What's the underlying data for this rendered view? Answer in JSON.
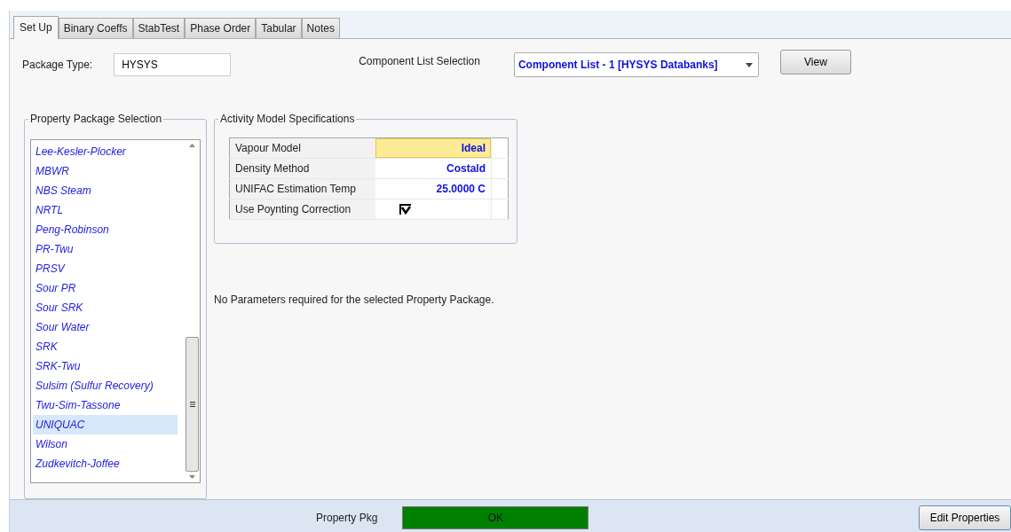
{
  "tabs": [
    {
      "label": "Set Up",
      "selected": true
    },
    {
      "label": "Binary Coeffs",
      "selected": false
    },
    {
      "label": "StabTest",
      "selected": false
    },
    {
      "label": "Phase Order",
      "selected": false
    },
    {
      "label": "Tabular",
      "selected": false
    },
    {
      "label": "Notes",
      "selected": false
    }
  ],
  "package_type": {
    "label": "Package Type:",
    "value": "HYSYS"
  },
  "component_list": {
    "label": "Component List Selection",
    "value": "Component List - 1 [HYSYS Databanks]",
    "button": "View"
  },
  "property_package": {
    "title": "Property Package Selection",
    "items": [
      {
        "label": "Lee-Kesler-Plocker",
        "selected": false
      },
      {
        "label": "MBWR",
        "selected": false
      },
      {
        "label": "NBS Steam",
        "selected": false
      },
      {
        "label": "NRTL",
        "selected": false
      },
      {
        "label": "Peng-Robinson",
        "selected": false
      },
      {
        "label": "PR-Twu",
        "selected": false
      },
      {
        "label": "PRSV",
        "selected": false
      },
      {
        "label": "Sour PR",
        "selected": false
      },
      {
        "label": "Sour SRK",
        "selected": false
      },
      {
        "label": "Sour Water",
        "selected": false
      },
      {
        "label": "SRK",
        "selected": false
      },
      {
        "label": "SRK-Twu",
        "selected": false
      },
      {
        "label": "Sulsim (Sulfur Recovery)",
        "selected": false
      },
      {
        "label": "Twu-Sim-Tassone",
        "selected": false
      },
      {
        "label": "UNIQUAC",
        "selected": true
      },
      {
        "label": "Wilson",
        "selected": false
      },
      {
        "label": "Zudkevitch-Joffee",
        "selected": false
      }
    ]
  },
  "activity_model": {
    "title": "Activity Model Specifications",
    "rows": [
      {
        "kind": "value",
        "label": "Vapour Model",
        "value": "Ideal",
        "selected": true
      },
      {
        "kind": "value",
        "label": "Density Method",
        "value": "Costald",
        "selected": false
      },
      {
        "kind": "value",
        "label": "UNIFAC Estimation Temp",
        "value": "25.0000 C",
        "selected": false
      },
      {
        "kind": "checkbox",
        "label": "Use Poynting Correction",
        "checked": true,
        "selected": false
      }
    ]
  },
  "message": "No Parameters required for the selected Property Package.",
  "status_bar": {
    "label": "Property Pkg",
    "status": "OK",
    "color": "#008000",
    "button": "Edit Properties"
  }
}
